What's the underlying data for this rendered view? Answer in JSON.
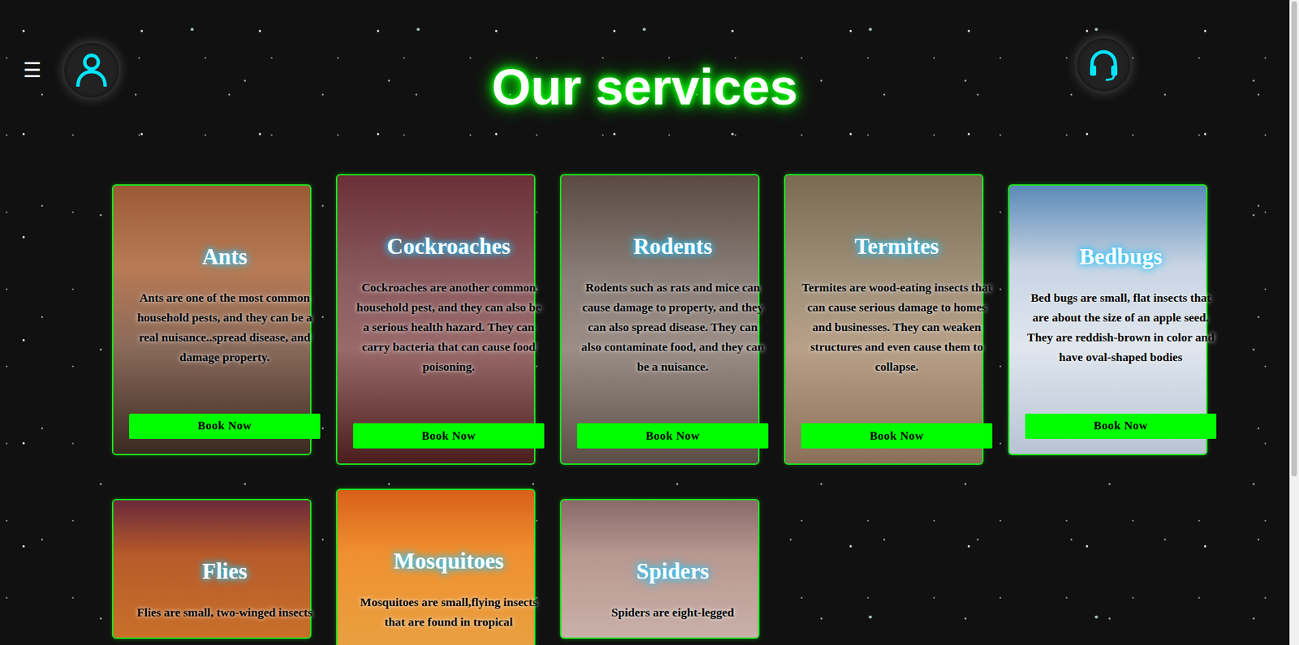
{
  "header": {
    "menu_icon": "☰",
    "title": "Our services"
  },
  "services": [
    {
      "title": "Ants",
      "description": "Ants are one of the most common household pests, and they can be a real nuisance..spread disease, and damage property.",
      "button": "Book Now"
    },
    {
      "title": "Cockroaches",
      "description": "Cockroaches are another common household pest, and they can also be a serious health hazard. They can carry bacteria that can cause food poisoning.",
      "button": "Book Now"
    },
    {
      "title": "Rodents",
      "description": "Rodents such as rats and mice can cause damage to property, and they can also spread disease. They can also contaminate food, and they can be a nuisance.",
      "button": "Book Now"
    },
    {
      "title": "Termites",
      "description": "Termites are wood-eating insects that can cause serious damage to homes and businesses. They can weaken structures and even cause them to collapse.",
      "button": "Book Now"
    },
    {
      "title": "Bedbugs",
      "description": "Bed bugs are small, flat insects that are about the size of an apple seed. They are reddish-brown in color and have oval-shaped bodies",
      "button": "Book Now"
    },
    {
      "title": "Flies",
      "description": "Flies are small, two-winged insects",
      "button": ""
    },
    {
      "title": "Mosquitoes",
      "description": "Mosquitoes are small,flying insects that are found in tropical",
      "button": ""
    },
    {
      "title": "Spiders",
      "description": "Spiders are eight-legged",
      "button": ""
    }
  ],
  "scrollbar": {
    "level": 0.74
  }
}
